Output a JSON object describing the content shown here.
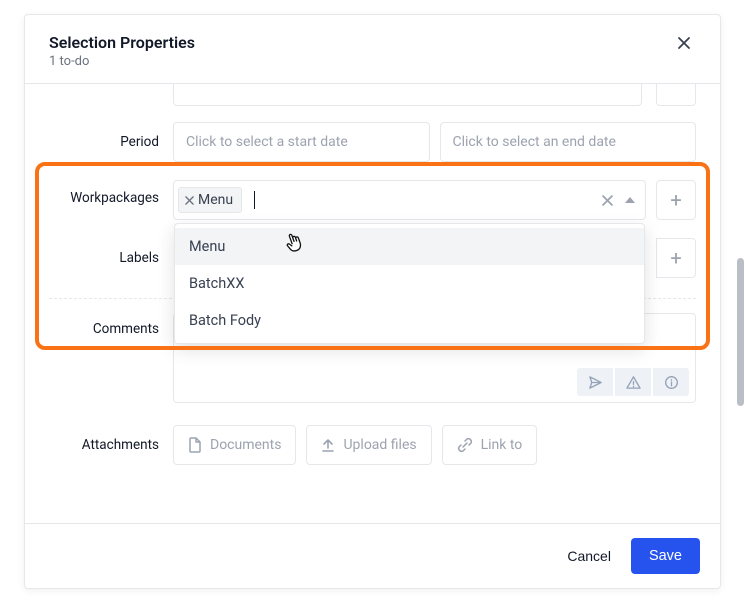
{
  "header": {
    "title": "Selection Properties",
    "subtitle": "1 to-do"
  },
  "rows": {
    "period_label": "Period",
    "start_placeholder": "Click to select a start date",
    "end_placeholder": "Click to select an end date",
    "workpackages_label": "Workpackages",
    "labels_label": "Labels",
    "comments_label": "Comments",
    "attachments_label": "Attachments"
  },
  "workpackages": {
    "selected_chip": "Menu",
    "options": [
      "Menu",
      "BatchXX",
      "Batch Fody"
    ],
    "hovered_index": 0
  },
  "attachments": {
    "documents": "Documents",
    "upload": "Upload files",
    "link": "Link to"
  },
  "footer": {
    "cancel": "Cancel",
    "save": "Save"
  }
}
